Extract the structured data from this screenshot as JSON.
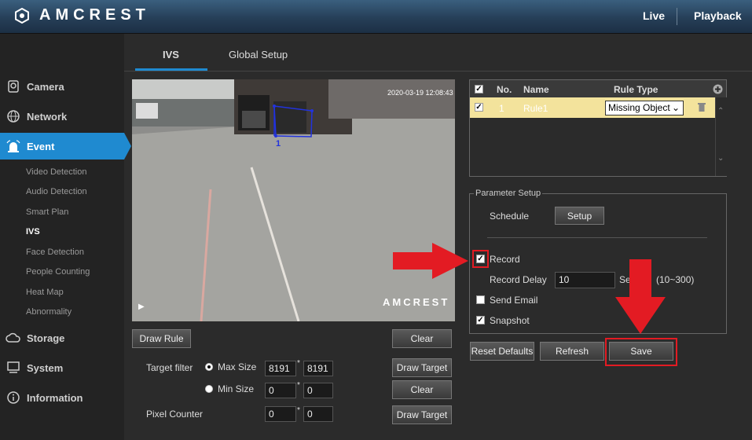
{
  "header": {
    "brand": "AMCREST",
    "links": [
      "Live",
      "Playback"
    ]
  },
  "sidebar": {
    "items": [
      {
        "label": "Camera"
      },
      {
        "label": "Network"
      },
      {
        "label": "Event"
      },
      {
        "label": "Storage"
      },
      {
        "label": "System"
      },
      {
        "label": "Information"
      }
    ],
    "event_subitems": [
      "Video Detection",
      "Audio Detection",
      "Smart Plan",
      "IVS",
      "Face Detection",
      "People Counting",
      "Heat Map",
      "Abnormality"
    ]
  },
  "tabs": [
    "IVS",
    "Global Setup"
  ],
  "video": {
    "timestamp": "2020-03-19 12:08:43",
    "watermark": "AMCREST",
    "rule_number": "1"
  },
  "controls": {
    "draw_rule": "Draw Rule",
    "clear": "Clear",
    "target_filter": "Target filter",
    "max_size": "Max Size",
    "min_size": "Min Size",
    "max_w": "8191",
    "max_h": "8191",
    "min_w": "0",
    "min_h": "0",
    "times": "*",
    "draw_target": "Draw Target",
    "pixel_counter": "Pixel Counter",
    "pix_w": "0",
    "pix_h": "0"
  },
  "rules": {
    "headers": [
      "No.",
      "Name",
      "Rule Type"
    ],
    "row": {
      "no": "1",
      "name": "Rule1",
      "type": "Missing Object"
    }
  },
  "params": {
    "legend": "Parameter Setup",
    "schedule": "Schedule",
    "setup": "Setup",
    "record": "Record",
    "record_delay": "Record Delay",
    "record_delay_value": "10",
    "seconds": "Sec.",
    "range": "(10~300)",
    "send_email": "Send Email",
    "snapshot": "Snapshot"
  },
  "actions": {
    "reset": "Reset Defaults",
    "refresh": "Refresh",
    "save": "Save"
  },
  "colors": {
    "accent": "#1f8ad0",
    "highlight": "#e31b23",
    "row_selected": "#f3e39c"
  }
}
